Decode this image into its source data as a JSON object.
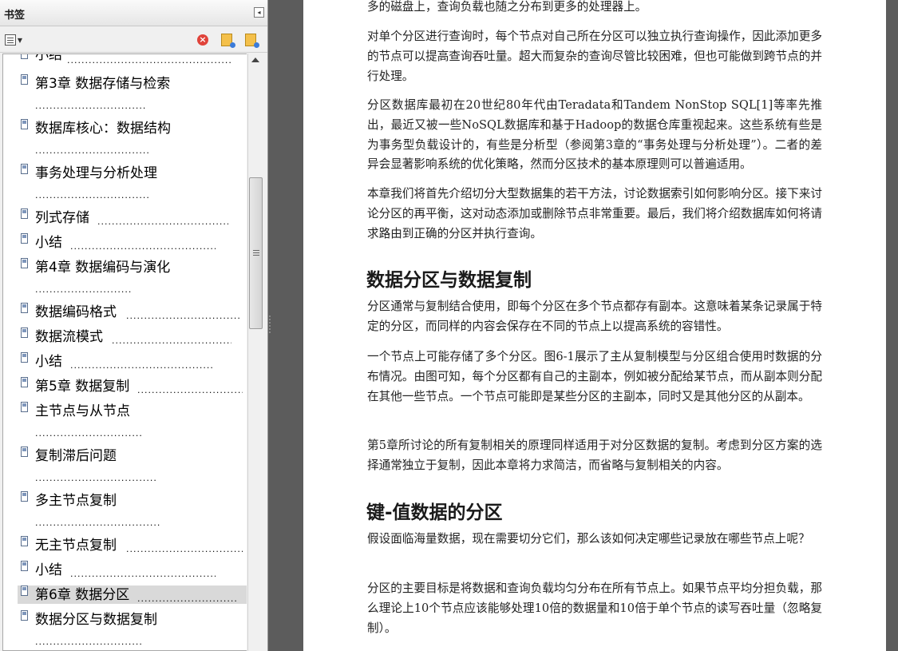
{
  "bookmarks_panel": {
    "title": "书签",
    "collapse_icon": "collapse-left-icon",
    "toolbar": {
      "options_icon": "options-menu-icon",
      "delete_icon": "delete-bookmark-icon",
      "expand_icon": "expand-bookmark-icon",
      "find_icon": "find-current-bookmark-icon"
    },
    "items": [
      {
        "label": "小结",
        "dots": "............................................................"
      },
      {
        "label": "第3章 数据存储与检索",
        "dots": "................................."
      },
      {
        "label": "数据库核心：数据结构",
        "dots": ".................................."
      },
      {
        "label": "事务处理与分析处理",
        "dots": ".................................."
      },
      {
        "label": "列式存储",
        "dots": "...................................................."
      },
      {
        "label": "小结",
        "dots": "............................................................"
      },
      {
        "label": "第4章 数据编码与演化",
        "dots": "................................."
      },
      {
        "label": "数据编码格式",
        "dots": "............................................"
      },
      {
        "label": "数据流模式",
        "dots": "..............................................."
      },
      {
        "label": "小结",
        "dots": "............................................................"
      },
      {
        "label": "第5章 数据复制",
        "dots": "..................................."
      },
      {
        "label": "主节点与从节点",
        "dots": "......................................"
      },
      {
        "label": "复制滞后问题",
        "dots": ".........................................."
      },
      {
        "label": "多主节点复制",
        "dots": ".........................................."
      },
      {
        "label": "无主节点复制",
        "dots": "..........................................."
      },
      {
        "label": "小结",
        "dots": "..............................................................."
      },
      {
        "label": "第6章 数据分区",
        "dots": "................................"
      },
      {
        "label": "数据分区与数据复制",
        "dots": "................................."
      }
    ],
    "selected_index": 16
  },
  "document": {
    "paragraphs": [
      "多的磁盘上，查询负载也随之分布到更多的处理器上。",
      "对单个分区进行查询时，每个节点对自己所在分区可以独立执行查询操作，因此添加更多的节点可以提高查询吞吐量。超大而复杂的查询尽管比较困难，但也可能做到跨节点的并行处理。",
      "分区数据库最初在20世纪80年代由Teradata和Tandem NonStop SQL[1]等率先推出，最近又被一些NoSQL数据库和基于Hadoop的数据仓库重视起来。这些系统有些是为事务型负载设计的，有些是分析型（参阅第3章的“事务处理与分析处理”）。二者的差异会显著影响系统的优化策略，然而分区技术的基本原理则可以普遍适用。",
      "本章我们将首先介绍切分大型数据集的若干方法，讨论数据索引如何影响分区。接下来讨论分区的再平衡，这对动态添加或删除节点非常重要。最后，我们将介绍数据库如何将请求路由到正确的分区并执行查询。"
    ],
    "heading1": "数据分区与数据复制",
    "section1_paragraphs": [
      "分区通常与复制结合使用，即每个分区在多个节点都存有副本。这意味着某条记录属于特定的分区，而同样的内容会保存在不同的节点上以提高系统的容错性。",
      "一个节点上可能存储了多个分区。图6-1展示了主从复制模型与分区组合使用时数据的分布情况。由图可知，每个分区都有自己的主副本，例如被分配给某节点，而从副本则分配在其他一些节点。一个节点可能即是某些分区的主副本，同时又是其他分区的从副本。",
      "第5章所讨论的所有复制相关的原理同样适用于对分区数据的复制。考虑到分区方案的选择通常独立于复制，因此本章将力求简洁，而省略与复制相关的内容。"
    ],
    "heading2": "键-值数据的分区",
    "section2_paragraphs": [
      "假设面临海量数据，现在需要切分它们，那么该如何决定哪些记录放在哪些节点上呢？",
      "分区的主要目标是将数据和查询负载均匀分布在所有节点上。如果节点平均分担负载，那么理论上10个节点应该能够处理10倍的数据量和10倍于单个节点的读写吞吐量（忽略复制）。"
    ]
  }
}
